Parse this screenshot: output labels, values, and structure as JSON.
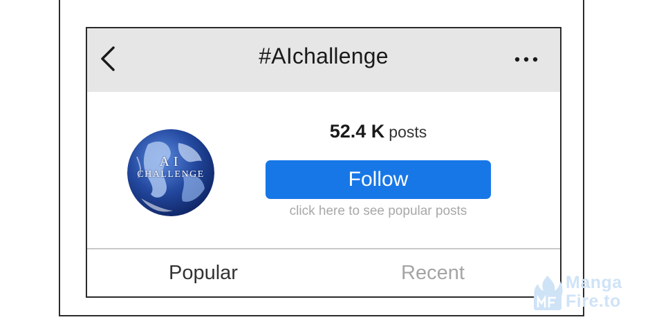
{
  "app": {
    "title": "#AIchallenge"
  },
  "nav": {
    "back_icon": "chevron-left-icon",
    "more_icon": "ellipsis-horizontal-icon"
  },
  "profile": {
    "avatar_line1": "AI",
    "avatar_line2": "CHALLENGE",
    "posts_number": "52.4 K",
    "posts_label": "posts",
    "follow_label": "Follow",
    "helper_text": "click here to see popular posts"
  },
  "tabs": [
    {
      "label": "Popular",
      "active": true
    },
    {
      "label": "Recent",
      "active": false
    }
  ],
  "watermark": {
    "line1": "Manga",
    "line2": "Fire.to"
  },
  "colors": {
    "accent": "#1877e6",
    "nav_background": "#e6e6e6",
    "active_tab_text": "#333333",
    "inactive_tab_text": "#a4a4a4",
    "helper_text": "#a8a8a8"
  }
}
